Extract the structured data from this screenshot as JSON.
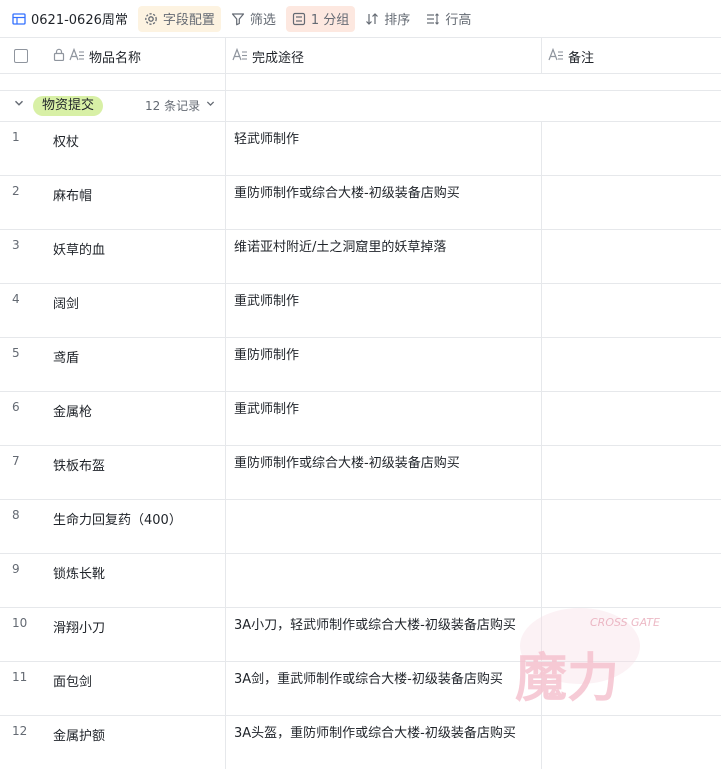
{
  "toolbar": {
    "view_name": "0621-0626周常",
    "field_config": "字段配置",
    "filter": "筛选",
    "group": "1 分组",
    "sort": "排序",
    "row_height": "行高"
  },
  "columns": {
    "name": "物品名称",
    "path": "完成途径",
    "note": "备注"
  },
  "group": {
    "label": "物资提交",
    "count": "12 条记录"
  },
  "rows": [
    {
      "num": "1",
      "name": "权杖",
      "path": "轻武师制作",
      "note": ""
    },
    {
      "num": "2",
      "name": "麻布帽",
      "path": "重防师制作或综合大楼-初级装备店购买",
      "note": ""
    },
    {
      "num": "3",
      "name": "妖草的血",
      "path": "维诺亚村附近/土之洞窟里的妖草掉落",
      "note": ""
    },
    {
      "num": "4",
      "name": "阔剑",
      "path": "重武师制作",
      "note": ""
    },
    {
      "num": "5",
      "name": "鸢盾",
      "path": "重防师制作",
      "note": ""
    },
    {
      "num": "6",
      "name": "金属枪",
      "path": "重武师制作",
      "note": ""
    },
    {
      "num": "7",
      "name": "铁板布盔",
      "path": "重防师制作或综合大楼-初级装备店购买",
      "note": ""
    },
    {
      "num": "8",
      "name": "生命力回复药（400）",
      "path": "",
      "note": ""
    },
    {
      "num": "9",
      "name": "锁炼长靴",
      "path": "",
      "note": ""
    },
    {
      "num": "10",
      "name": "滑翔小刀",
      "path": "3A小刀，轻武师制作或综合大楼-初级装备店购买",
      "note": ""
    },
    {
      "num": "11",
      "name": "面包剑",
      "path": "3A剑，重武师制作或综合大楼-初级装备店购买",
      "note": ""
    },
    {
      "num": "12",
      "name": "金属护额",
      "path": "3A头盔，重防师制作或综合大楼-初级装备店购买",
      "note": ""
    }
  ],
  "watermark": {
    "main": "魔力",
    "sub": "CROSS GATE"
  },
  "colors": {
    "accent": "#3370ff",
    "group_tag": "#d8f0a6",
    "field_config_bg": "#fdf3e1",
    "group_bg": "#fde8e0",
    "grid_line": "#e6e8eb",
    "watermark": "#f2b8c6"
  }
}
